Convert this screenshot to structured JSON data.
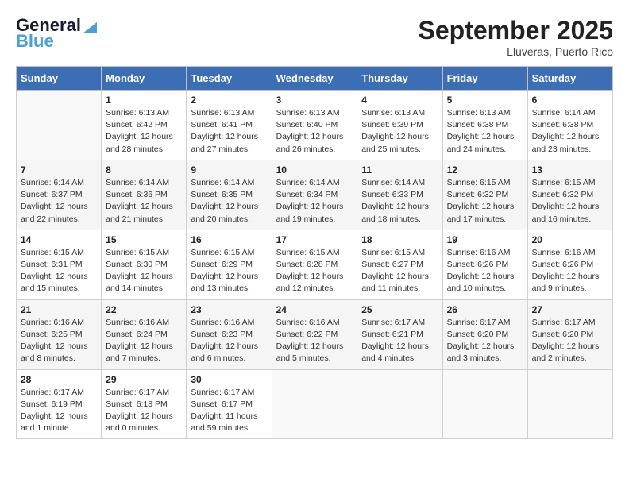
{
  "header": {
    "logo_line1": "General",
    "logo_line2": "Blue",
    "main_title": "September 2025",
    "subtitle": "Lluveras, Puerto Rico"
  },
  "columns": [
    "Sunday",
    "Monday",
    "Tuesday",
    "Wednesday",
    "Thursday",
    "Friday",
    "Saturday"
  ],
  "weeks": [
    [
      {
        "day": "",
        "info": ""
      },
      {
        "day": "1",
        "info": "Sunrise: 6:13 AM\nSunset: 6:42 PM\nDaylight: 12 hours\nand 28 minutes."
      },
      {
        "day": "2",
        "info": "Sunrise: 6:13 AM\nSunset: 6:41 PM\nDaylight: 12 hours\nand 27 minutes."
      },
      {
        "day": "3",
        "info": "Sunrise: 6:13 AM\nSunset: 6:40 PM\nDaylight: 12 hours\nand 26 minutes."
      },
      {
        "day": "4",
        "info": "Sunrise: 6:13 AM\nSunset: 6:39 PM\nDaylight: 12 hours\nand 25 minutes."
      },
      {
        "day": "5",
        "info": "Sunrise: 6:13 AM\nSunset: 6:38 PM\nDaylight: 12 hours\nand 24 minutes."
      },
      {
        "day": "6",
        "info": "Sunrise: 6:14 AM\nSunset: 6:38 PM\nDaylight: 12 hours\nand 23 minutes."
      }
    ],
    [
      {
        "day": "7",
        "info": "Sunrise: 6:14 AM\nSunset: 6:37 PM\nDaylight: 12 hours\nand 22 minutes."
      },
      {
        "day": "8",
        "info": "Sunrise: 6:14 AM\nSunset: 6:36 PM\nDaylight: 12 hours\nand 21 minutes."
      },
      {
        "day": "9",
        "info": "Sunrise: 6:14 AM\nSunset: 6:35 PM\nDaylight: 12 hours\nand 20 minutes."
      },
      {
        "day": "10",
        "info": "Sunrise: 6:14 AM\nSunset: 6:34 PM\nDaylight: 12 hours\nand 19 minutes."
      },
      {
        "day": "11",
        "info": "Sunrise: 6:14 AM\nSunset: 6:33 PM\nDaylight: 12 hours\nand 18 minutes."
      },
      {
        "day": "12",
        "info": "Sunrise: 6:15 AM\nSunset: 6:32 PM\nDaylight: 12 hours\nand 17 minutes."
      },
      {
        "day": "13",
        "info": "Sunrise: 6:15 AM\nSunset: 6:32 PM\nDaylight: 12 hours\nand 16 minutes."
      }
    ],
    [
      {
        "day": "14",
        "info": "Sunrise: 6:15 AM\nSunset: 6:31 PM\nDaylight: 12 hours\nand 15 minutes."
      },
      {
        "day": "15",
        "info": "Sunrise: 6:15 AM\nSunset: 6:30 PM\nDaylight: 12 hours\nand 14 minutes."
      },
      {
        "day": "16",
        "info": "Sunrise: 6:15 AM\nSunset: 6:29 PM\nDaylight: 12 hours\nand 13 minutes."
      },
      {
        "day": "17",
        "info": "Sunrise: 6:15 AM\nSunset: 6:28 PM\nDaylight: 12 hours\nand 12 minutes."
      },
      {
        "day": "18",
        "info": "Sunrise: 6:15 AM\nSunset: 6:27 PM\nDaylight: 12 hours\nand 11 minutes."
      },
      {
        "day": "19",
        "info": "Sunrise: 6:16 AM\nSunset: 6:26 PM\nDaylight: 12 hours\nand 10 minutes."
      },
      {
        "day": "20",
        "info": "Sunrise: 6:16 AM\nSunset: 6:26 PM\nDaylight: 12 hours\nand 9 minutes."
      }
    ],
    [
      {
        "day": "21",
        "info": "Sunrise: 6:16 AM\nSunset: 6:25 PM\nDaylight: 12 hours\nand 8 minutes."
      },
      {
        "day": "22",
        "info": "Sunrise: 6:16 AM\nSunset: 6:24 PM\nDaylight: 12 hours\nand 7 minutes."
      },
      {
        "day": "23",
        "info": "Sunrise: 6:16 AM\nSunset: 6:23 PM\nDaylight: 12 hours\nand 6 minutes."
      },
      {
        "day": "24",
        "info": "Sunrise: 6:16 AM\nSunset: 6:22 PM\nDaylight: 12 hours\nand 5 minutes."
      },
      {
        "day": "25",
        "info": "Sunrise: 6:17 AM\nSunset: 6:21 PM\nDaylight: 12 hours\nand 4 minutes."
      },
      {
        "day": "26",
        "info": "Sunrise: 6:17 AM\nSunset: 6:20 PM\nDaylight: 12 hours\nand 3 minutes."
      },
      {
        "day": "27",
        "info": "Sunrise: 6:17 AM\nSunset: 6:20 PM\nDaylight: 12 hours\nand 2 minutes."
      }
    ],
    [
      {
        "day": "28",
        "info": "Sunrise: 6:17 AM\nSunset: 6:19 PM\nDaylight: 12 hours\nand 1 minute."
      },
      {
        "day": "29",
        "info": "Sunrise: 6:17 AM\nSunset: 6:18 PM\nDaylight: 12 hours\nand 0 minutes."
      },
      {
        "day": "30",
        "info": "Sunrise: 6:17 AM\nSunset: 6:17 PM\nDaylight: 11 hours\nand 59 minutes."
      },
      {
        "day": "",
        "info": ""
      },
      {
        "day": "",
        "info": ""
      },
      {
        "day": "",
        "info": ""
      },
      {
        "day": "",
        "info": ""
      }
    ]
  ]
}
